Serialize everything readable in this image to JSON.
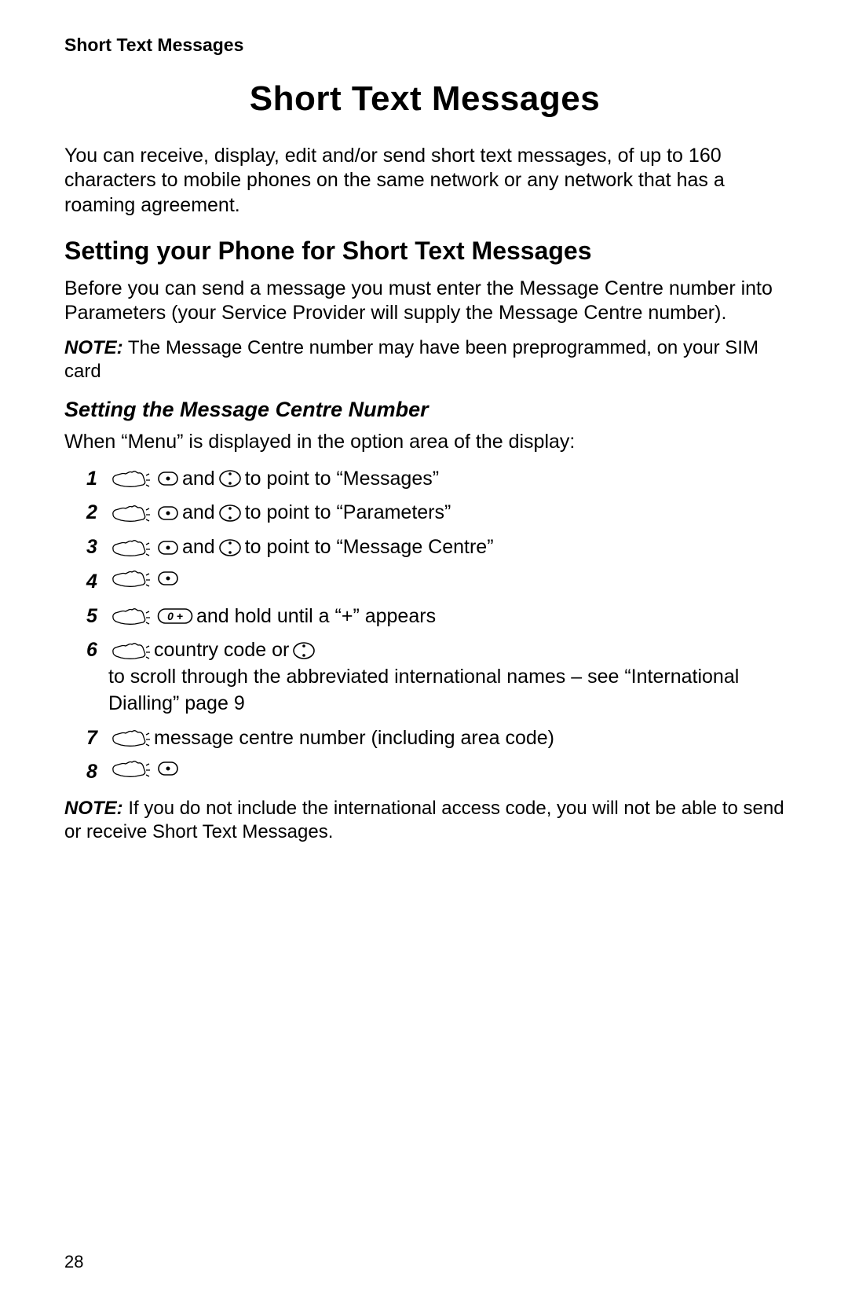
{
  "header": "Short Text Messages",
  "title": "Short Text Messages",
  "intro": "You can receive, display, edit and/or send short text messages, of up to 160 characters to mobile phones on the same network or any network that has a roaming agreement.",
  "section_heading": "Setting your Phone for Short Text Messages",
  "section_intro": "Before you can send a message you must enter the Message Centre number into Parameters (your Service Provider will supply the Message Centre number).",
  "note1_label": "NOTE:",
  "note1_text": " The Message Centre number may have been preprogrammed, on your SIM card",
  "sub_heading": "Setting the Message Centre Number",
  "when_text": "When “Menu” is displayed in the option area of the display:",
  "steps": {
    "s1": {
      "num": "1",
      "t1": " and ",
      "t2": " to point to “Messages”"
    },
    "s2": {
      "num": "2",
      "t1": " and ",
      "t2": " to point to “Parameters”"
    },
    "s3": {
      "num": "3",
      "t1": " and ",
      "t2": " to point to “Message Centre”"
    },
    "s4": {
      "num": "4"
    },
    "s5": {
      "num": "5",
      "key": "0 +",
      "t1": " and hold until a “+” appears"
    },
    "s6": {
      "num": "6",
      "t1": " country code or ",
      "t2": " to scroll through the abbreviated international names – see “International Dialling” page 9"
    },
    "s7": {
      "num": "7",
      "t1": " message centre number (including area code)"
    },
    "s8": {
      "num": "8"
    }
  },
  "note2_label": "NOTE:",
  "note2_text": " If you do not include the international access code, you will not be able to send or receive Short Text Messages.",
  "page_num": "28"
}
